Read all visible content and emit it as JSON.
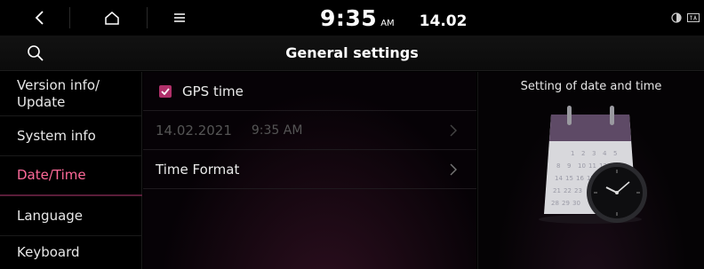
{
  "statusbar": {
    "time": "9:35",
    "ampm": "AM",
    "date": "14.02"
  },
  "titlebar": {
    "title": "General settings"
  },
  "sidebar": {
    "items": [
      {
        "label": "Version info/\nUpdate",
        "active": false
      },
      {
        "label": "System info",
        "active": false
      },
      {
        "label": "Date/Time",
        "active": true
      },
      {
        "label": "Language",
        "active": false
      },
      {
        "label": "Keyboard",
        "active": false
      }
    ]
  },
  "content": {
    "gps_time": {
      "label": "GPS time",
      "checked": true
    },
    "datetime_row": {
      "date": "14.02.2021",
      "time": "9:35 AM"
    },
    "time_format": {
      "label": "Time Format"
    }
  },
  "infopanel": {
    "title": "Setting of date and time"
  },
  "colors": {
    "accent": "#ff6a9a",
    "checkbox": "#b0306a"
  }
}
